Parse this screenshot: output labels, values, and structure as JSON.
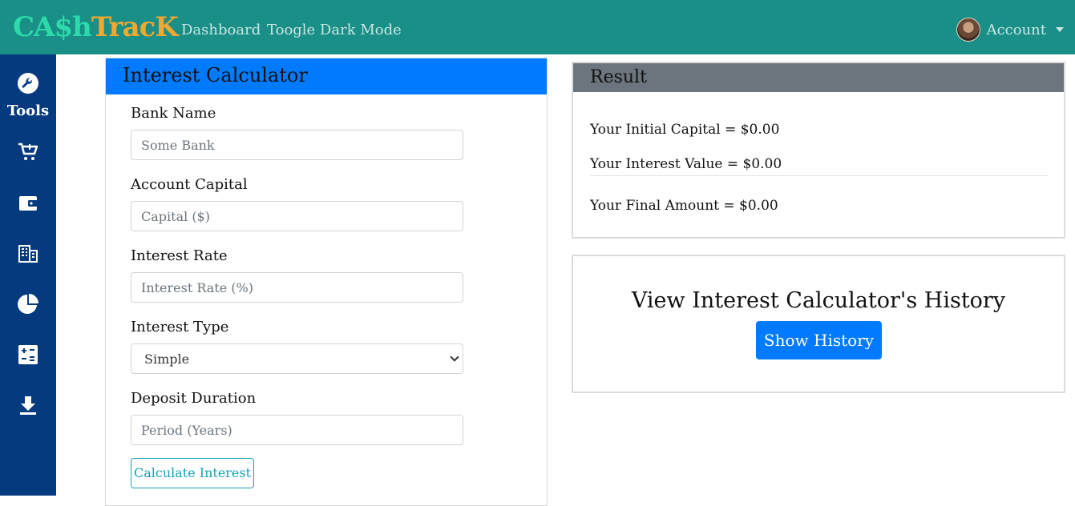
{
  "brand": {
    "part1": "CA$h",
    "part2": "TracK"
  },
  "nav": {
    "dashboard": "Dashboard",
    "dark_mode": "Toogle Dark Mode"
  },
  "account": {
    "label": "Account"
  },
  "sidebar": {
    "tools_label": "Tools"
  },
  "calculator": {
    "title": "Interest Calculator",
    "bank_name_label": "Bank Name",
    "bank_name_placeholder": "Some Bank",
    "capital_label": "Account Capital",
    "capital_placeholder": "Capital ($)",
    "rate_label": "Interest Rate",
    "rate_placeholder": "Interest Rate (%)",
    "type_label": "Interest Type",
    "type_selected": "Simple",
    "duration_label": "Deposit Duration",
    "duration_placeholder": "Period (Years)",
    "calculate_button": "Calculate Interest"
  },
  "result": {
    "title": "Result",
    "initial_capital": "Your Initial Capital = $0.00",
    "interest_value": "Your Interest Value = $0.00",
    "final_amount": "Your Final Amount = $0.00"
  },
  "history": {
    "title": "View Interest Calculator's History",
    "button": "Show History"
  },
  "colors": {
    "topbar": "#198f87",
    "sidebar": "#063a7e",
    "primary": "#007bff",
    "secondary": "#6c757d",
    "info": "#17a2b8"
  }
}
